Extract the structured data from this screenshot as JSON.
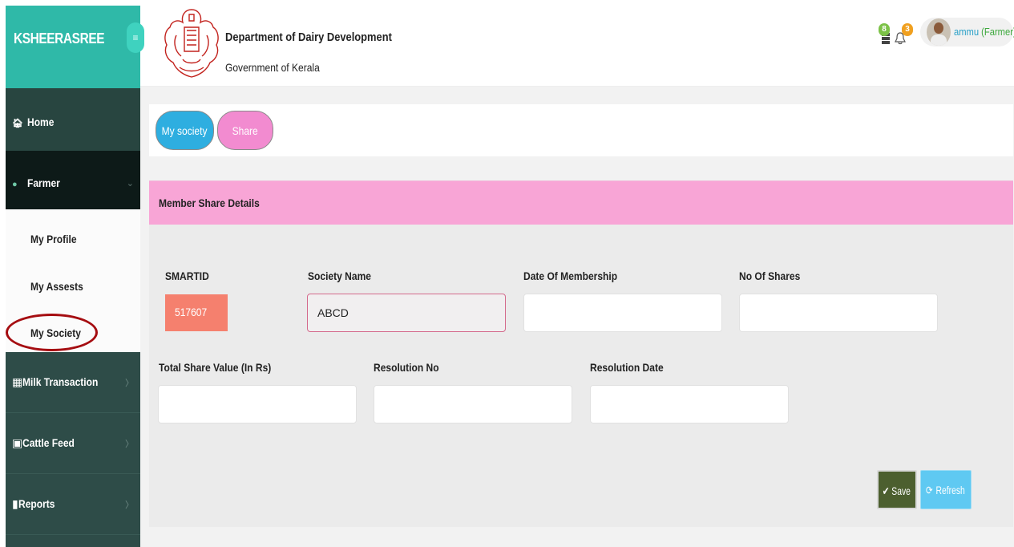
{
  "sidebar": {
    "brand": "KSHEERASREE",
    "menu_toggle_icon": "hamburger-icon",
    "home": "Home",
    "farmer": "Farmer",
    "sub_items": [
      "My Profile",
      "My Assests",
      "My Society"
    ],
    "milk_transaction": "Milk Transaction",
    "cattle_feed": "Cattle Feed",
    "reports": "Reports"
  },
  "header": {
    "title": "Department of Dairy Development",
    "subtitle": "Government of Kerala",
    "messages_count": "8",
    "notifications_count": "3",
    "user_name": "ammu",
    "user_role": "(Farmer)"
  },
  "tabs": {
    "my_society": "My society",
    "share": "Share"
  },
  "panel": {
    "title": "Member Share Details"
  },
  "form": {
    "smartid_label": "SMARTID",
    "smartid_value": "517607",
    "society_name_label": "Society Name",
    "society_name_value": "ABCD",
    "date_of_membership_label": "Date Of Membership",
    "date_of_membership_value": "",
    "no_of_shares_label": "No Of Shares",
    "no_of_shares_value": "",
    "total_share_value_label": "Total Share Value (In Rs)",
    "total_share_value_value": "",
    "resolution_no_label": "Resolution No",
    "resolution_no_value": "",
    "resolution_date_label": "Resolution Date",
    "resolution_date_value": ""
  },
  "buttons": {
    "save": "Save",
    "refresh": "Refresh"
  },
  "colors": {
    "brand_teal": "#2fb9a8",
    "sidebar_dark": "#2e4c48",
    "panel_pink": "#f8a5d6",
    "tab_blue": "#2eaee0",
    "tab_pink": "#f28bd0",
    "smartid_salmon": "#f5806e",
    "save_green": "#4c5f2f",
    "refresh_blue": "#5fc9f2",
    "highlight_circle": "#a50d11"
  }
}
